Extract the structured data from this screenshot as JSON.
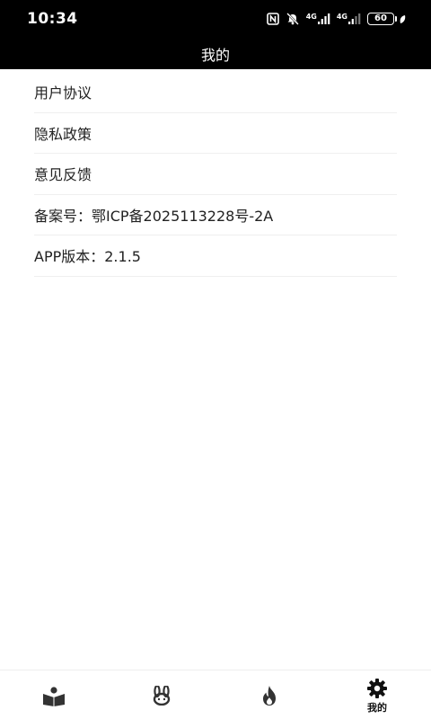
{
  "status_bar": {
    "time": "10:34",
    "network_1": "4G",
    "network_2": "4G",
    "battery": "60"
  },
  "header": {
    "title": "我的"
  },
  "menu": {
    "items": [
      {
        "label": "用户协议"
      },
      {
        "label": "隐私政策"
      },
      {
        "label": "意见反馈"
      },
      {
        "label": "备案号：鄂ICP备2025113228号-2A"
      },
      {
        "label": "APP版本：2.1.5"
      }
    ]
  },
  "bottom_nav": {
    "items": [
      {
        "icon": "reading-icon",
        "label": ""
      },
      {
        "icon": "rabbit-icon",
        "label": ""
      },
      {
        "icon": "flame-icon",
        "label": ""
      },
      {
        "icon": "gear-icon",
        "label": "我的",
        "active": true
      }
    ]
  }
}
